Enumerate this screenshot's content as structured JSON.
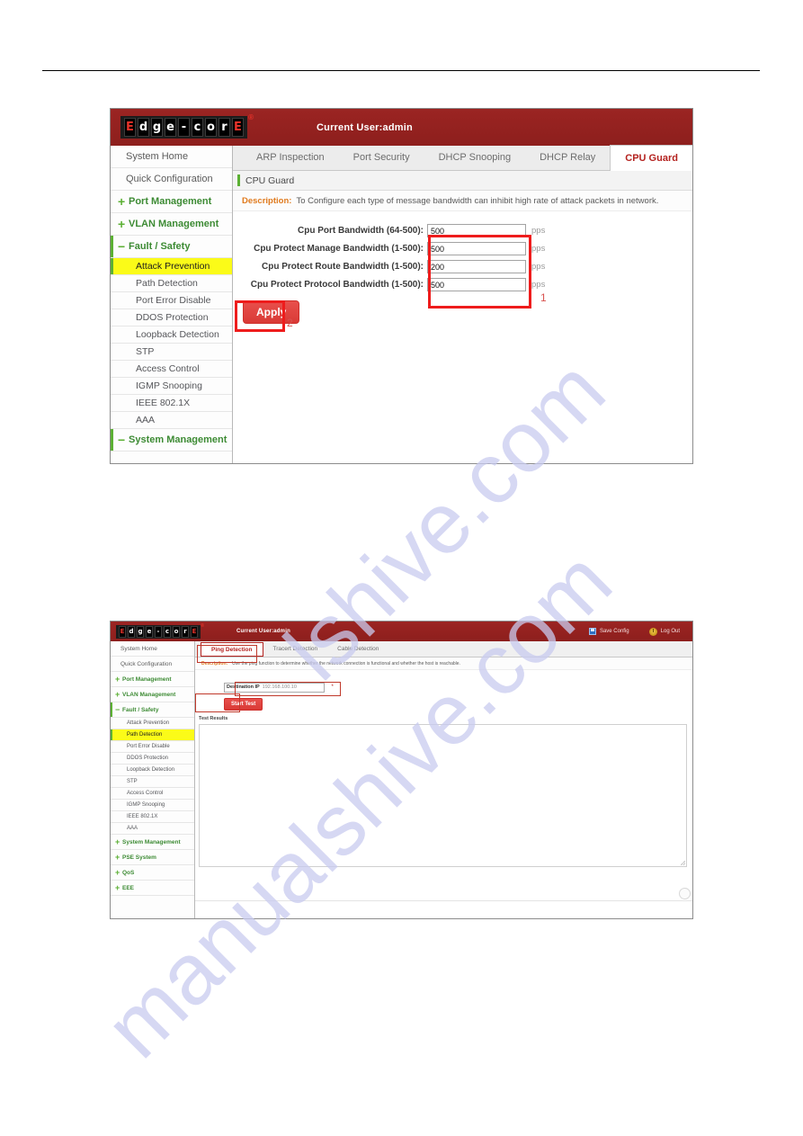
{
  "screenshot1": {
    "header": {
      "logo_letters": [
        "E",
        "d",
        "g",
        "e",
        "-",
        "c",
        "o",
        "r",
        "E"
      ],
      "registered_mark": "®",
      "current_user": "Current User:admin"
    },
    "sidebar": {
      "items": [
        {
          "label": "System Home",
          "type": "link",
          "state": "normal"
        },
        {
          "label": "Quick Configuration",
          "type": "link",
          "state": "normal"
        },
        {
          "label": "Port Management",
          "type": "group",
          "sign": "+",
          "state": "collapsed"
        },
        {
          "label": "VLAN Management",
          "type": "group",
          "sign": "+",
          "state": "collapsed"
        },
        {
          "label": "Fault / Safety",
          "type": "group",
          "sign": "−",
          "state": "open"
        },
        {
          "label": "Attack Prevention",
          "type": "child",
          "state": "active"
        },
        {
          "label": "Path Detection",
          "type": "child",
          "state": "normal"
        },
        {
          "label": "Port Error Disable",
          "type": "child",
          "state": "normal"
        },
        {
          "label": "DDOS Protection",
          "type": "child",
          "state": "normal"
        },
        {
          "label": "Loopback Detection",
          "type": "child",
          "state": "normal"
        },
        {
          "label": "STP",
          "type": "child",
          "state": "normal"
        },
        {
          "label": "Access Control",
          "type": "child",
          "state": "normal"
        },
        {
          "label": "IGMP Snooping",
          "type": "child",
          "state": "normal"
        },
        {
          "label": "IEEE 802.1X",
          "type": "child",
          "state": "normal"
        },
        {
          "label": "AAA",
          "type": "child",
          "state": "normal"
        },
        {
          "label": "System Management",
          "type": "group",
          "sign": "−",
          "state": "open"
        }
      ]
    },
    "tabs": [
      {
        "label": "ARP Inspection",
        "active": false
      },
      {
        "label": "Port Security",
        "active": false
      },
      {
        "label": "DHCP Snooping",
        "active": false
      },
      {
        "label": "DHCP Relay",
        "active": false
      },
      {
        "label": "CPU Guard",
        "active": true
      }
    ],
    "panel_title": "CPU Guard",
    "description": {
      "key": "Description:",
      "value": "To Configure each type of message bandwidth can inhibit high rate of attack packets in network."
    },
    "form": {
      "rows": [
        {
          "label": "Cpu Port Bandwidth (64-500):",
          "value": "500",
          "unit": "pps"
        },
        {
          "label": "Cpu Protect Manage Bandwidth (1-500):",
          "value": "500",
          "unit": "pps"
        },
        {
          "label": "Cpu Protect Route Bandwidth (1-500):",
          "value": "200",
          "unit": "pps"
        },
        {
          "label": "Cpu Protect Protocol Bandwidth (1-500):",
          "value": "500",
          "unit": "pps"
        }
      ],
      "apply_label": "Apply"
    },
    "annotations": [
      {
        "number": "1",
        "target": "bandwidth-fields"
      },
      {
        "number": "2",
        "target": "apply-button"
      }
    ]
  },
  "screenshot2": {
    "header": {
      "logo_letters": [
        "E",
        "d",
        "g",
        "e",
        "-",
        "c",
        "o",
        "r",
        "E"
      ],
      "registered_mark": "®",
      "current_user": "Current User:admin",
      "save_config_label": "Save Config",
      "log_out_label": "Log Out"
    },
    "sidebar": {
      "items": [
        {
          "label": "System Home",
          "type": "link",
          "state": "normal"
        },
        {
          "label": "Quick Configuration",
          "type": "link",
          "state": "normal"
        },
        {
          "label": "Port Management",
          "type": "group",
          "sign": "+",
          "state": "collapsed"
        },
        {
          "label": "VLAN Management",
          "type": "group",
          "sign": "+",
          "state": "collapsed"
        },
        {
          "label": "Fault / Safety",
          "type": "group",
          "sign": "−",
          "state": "open"
        },
        {
          "label": "Attack Prevention",
          "type": "child",
          "state": "normal"
        },
        {
          "label": "Path Detection",
          "type": "child",
          "state": "active"
        },
        {
          "label": "Port Error Disable",
          "type": "child",
          "state": "normal"
        },
        {
          "label": "DDOS Protection",
          "type": "child",
          "state": "normal"
        },
        {
          "label": "Loopback Detection",
          "type": "child",
          "state": "normal"
        },
        {
          "label": "STP",
          "type": "child",
          "state": "normal"
        },
        {
          "label": "Access Control",
          "type": "child",
          "state": "normal"
        },
        {
          "label": "IGMP Snooping",
          "type": "child",
          "state": "normal"
        },
        {
          "label": "IEEE 802.1X",
          "type": "child",
          "state": "normal"
        },
        {
          "label": "AAA",
          "type": "child",
          "state": "normal"
        },
        {
          "label": "System Management",
          "type": "group",
          "sign": "+",
          "state": "collapsed"
        },
        {
          "label": "PSE System",
          "type": "group",
          "sign": "+",
          "state": "collapsed"
        },
        {
          "label": "QoS",
          "type": "group",
          "sign": "+",
          "state": "collapsed"
        },
        {
          "label": "EEE",
          "type": "group",
          "sign": "+",
          "state": "collapsed"
        }
      ]
    },
    "tabs": [
      {
        "label": "Ping Detection",
        "active": true
      },
      {
        "label": "Tracert Detection",
        "active": false
      },
      {
        "label": "Cable Detection",
        "active": false
      }
    ],
    "description": {
      "key": "Description:",
      "value": "Use the ping function to determine whether the network connection is functional and whether the host is reachable."
    },
    "form": {
      "destination_label": "Destination IP",
      "destination_placeholder": "192.168.100.10",
      "required_mark": "*",
      "start_test_label": "Start Test"
    },
    "results": {
      "label": "Test Results",
      "value": ""
    }
  },
  "watermark": {
    "text_1": "lshive.com",
    "text_2": "manualshive.com"
  },
  "colors": {
    "header_red": "#97211f",
    "accent_green": "#5bb033",
    "active_yellow": "#fbfb18",
    "tab_active_red": "#b4221f",
    "annotation_red": "#ee1c1c",
    "button_red": "#d93a36",
    "description_orange": "#e07b1f"
  }
}
